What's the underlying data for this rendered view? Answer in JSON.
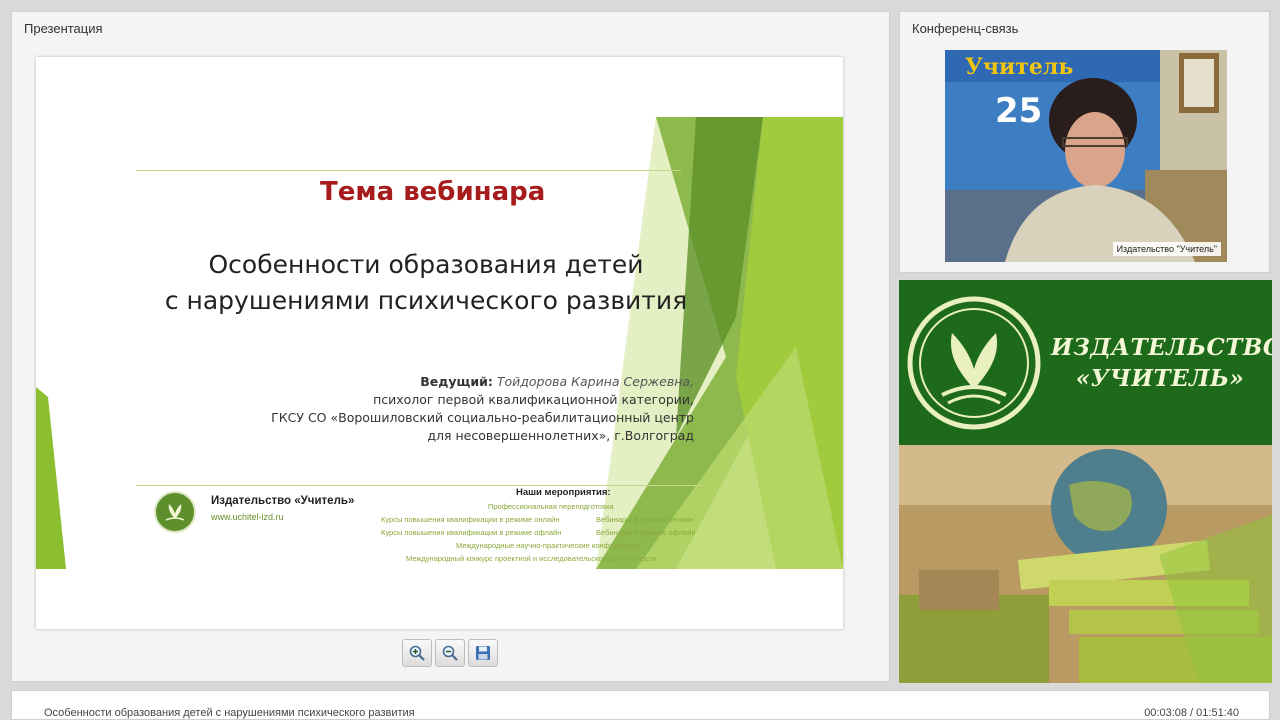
{
  "presentation": {
    "panel_title": "Презентация",
    "slide": {
      "topic_label": "Тема вебинара",
      "topic_title_line1": "Особенности образования детей",
      "topic_title_line2": "с нарушениями психического развития",
      "presenter_label": "Ведущий:",
      "presenter_name": "Тойдорова Карина Сержевна,",
      "presenter_line2": "психолог первой квалификационной категории,",
      "presenter_line3": "ГКСУ СО «Ворошиловский социально-реабилитационный центр",
      "presenter_line4": "для несовершеннолетних», г.Волгоград",
      "footer_publisher": "Издательство «Учитель»",
      "footer_url": "www.uchitel-izd.ru",
      "events_title": "Наши мероприятия:",
      "events": [
        "Профессиональная переподготовка",
        "Курсы повышения квалификации в режиме онлайн",
        "Вебинары в режиме онлайн",
        "Курсы повышения квалификации в режиме офлайн",
        "Вебинары в режиме офлайн",
        "Международные научно-практические конференции",
        "Международный конкурс проектной и исследовательской деятельности"
      ]
    },
    "toolbar": {
      "zoom_in_icon": "zoom-in-icon",
      "zoom_out_icon": "zoom-out-icon",
      "save_icon": "save-icon"
    }
  },
  "conference": {
    "panel_title": "Конференц-связь",
    "video_caption": "Издательство \"Учитель\"",
    "poster_text": "Учитель",
    "poster_number": "25"
  },
  "banner": {
    "name_line1": "ИЗДАТЕЛЬСТВО",
    "name_line2": "«УЧИТЕЛЬ»"
  },
  "status": {
    "title": "Особенности образования детей с нарушениями психического развития",
    "time": "00:03:08 / 01:51:40"
  },
  "colors": {
    "accent_green": "#1d6a1a",
    "title_red": "#a61b1b",
    "slide_green": "#8cbf2f"
  }
}
